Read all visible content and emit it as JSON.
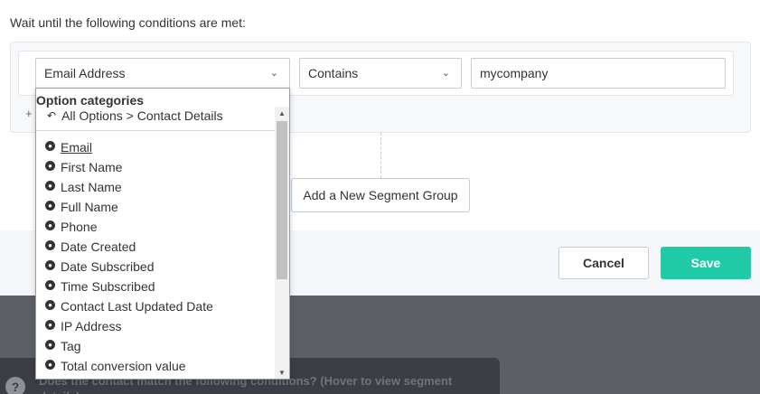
{
  "instruction": "Wait until the following conditions are met:",
  "condition": {
    "field": "Email Address",
    "operator": "Contains",
    "value": "mycompany"
  },
  "add_condition_symbol": "+",
  "add_group_label": "Add a New Segment Group",
  "footer": {
    "cancel_label": "Cancel",
    "save_label": "Save"
  },
  "dropdown": {
    "title": "Option categories",
    "back_label": "All Options > Contact Details",
    "items": [
      {
        "label": "Email"
      },
      {
        "label": "First Name"
      },
      {
        "label": "Last Name"
      },
      {
        "label": "Full Name"
      },
      {
        "label": "Phone"
      },
      {
        "label": "Date Created"
      },
      {
        "label": "Date Subscribed"
      },
      {
        "label": "Time Subscribed"
      },
      {
        "label": "Contact Last Updated Date"
      },
      {
        "label": "IP Address"
      },
      {
        "label": "Tag"
      },
      {
        "label": "Total conversion value"
      }
    ]
  },
  "tooltip": {
    "help_symbol": "?",
    "text": "Does the contact match the following conditions? (Hover to view segment details)"
  },
  "colors": {
    "accent": "#1fcca7",
    "overlay": "#5c5f66"
  }
}
